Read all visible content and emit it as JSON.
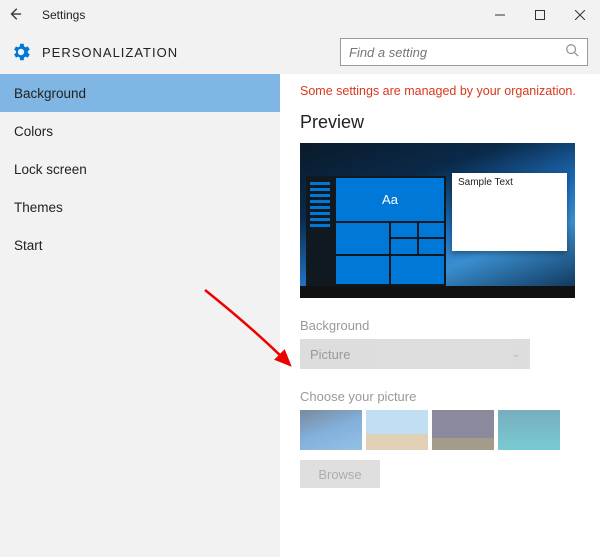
{
  "titlebar": {
    "title": "Settings"
  },
  "header": {
    "section": "PERSONALIZATION"
  },
  "search": {
    "placeholder": "Find a setting"
  },
  "sidebar": {
    "items": [
      {
        "label": "Background",
        "selected": true
      },
      {
        "label": "Colors"
      },
      {
        "label": "Lock screen"
      },
      {
        "label": "Themes"
      },
      {
        "label": "Start"
      }
    ]
  },
  "main": {
    "warning": "Some settings are managed by your organization.",
    "preview_heading": "Preview",
    "sample_text": "Sample Text",
    "tile_label": "Aa",
    "background_label": "Background",
    "background_value": "Picture",
    "choose_label": "Choose your picture",
    "browse_label": "Browse"
  }
}
